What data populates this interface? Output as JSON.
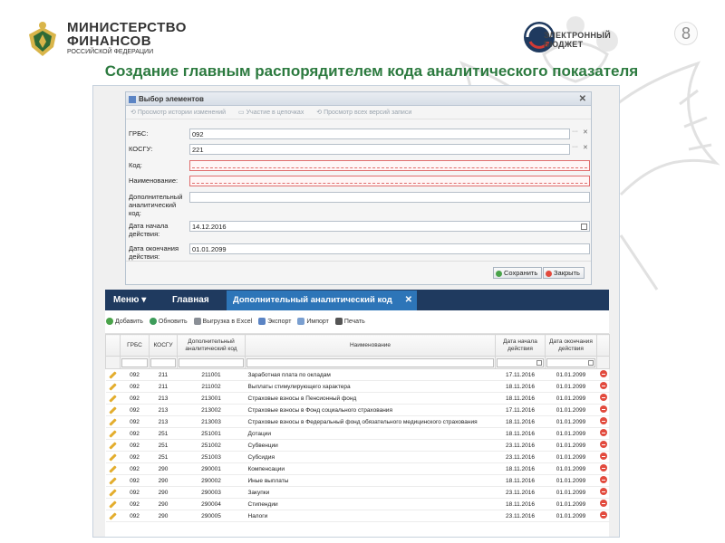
{
  "ministry": {
    "line1": "МИНИСТЕРСТВО",
    "line2": "ФИНАНСОВ",
    "line3": "РОССИЙСКОЙ ФЕДЕРАЦИИ"
  },
  "eb_logo": {
    "line1": "ЭЛЕКТРОННЫЙ",
    "line2": "БЮДЖЕТ"
  },
  "slide_number": "8",
  "title": "Создание главным распорядителем кода аналитического показателя",
  "modal": {
    "title": "Выбор элементов",
    "tools": [
      "Просмотр истории изменений",
      "Участие в цепочках",
      "Просмотр всех версий записи"
    ],
    "fields": [
      {
        "label": "ГРБС:",
        "value": "092"
      },
      {
        "label": "КОСГУ:",
        "value": "221"
      },
      {
        "label": "Код:",
        "value": ""
      },
      {
        "label": "Наименование:",
        "value": ""
      },
      {
        "label": "Дополнительный аналитический код:",
        "value": ""
      },
      {
        "label": "Дата начала действия:",
        "value": "14.12.2016"
      },
      {
        "label": "Дата окончания действия:",
        "value": "01.01.2099"
      }
    ],
    "save_label": "Сохранить",
    "close_label": "Закрыть"
  },
  "appbar": {
    "menu": "Меню",
    "main": "Главная",
    "active_tab": "Дополнительный аналитический код"
  },
  "toolbar": [
    "Добавить",
    "Обновить",
    "Выгрузка в Excel",
    "Экспорт",
    "Импорт",
    "Печать"
  ],
  "grid": {
    "headers": [
      "ГРБС",
      "КОСГУ",
      "Дополнительный аналитический код",
      "Наименование",
      "Дата начала действия",
      "Дата окончания действия"
    ],
    "rows": [
      [
        "092",
        "211",
        "211001",
        "Заработная плата по окладам",
        "17.11.2016",
        "01.01.2099"
      ],
      [
        "092",
        "211",
        "211002",
        "Выплаты стимулирующего характера",
        "18.11.2016",
        "01.01.2099"
      ],
      [
        "092",
        "213",
        "213001",
        "Страховые взносы в Пенсионный фонд",
        "18.11.2016",
        "01.01.2099"
      ],
      [
        "092",
        "213",
        "213002",
        "Страховые взносы в Фонд социального страхования",
        "17.11.2016",
        "01.01.2099"
      ],
      [
        "092",
        "213",
        "213003",
        "Страховые взносы в Федеральный фонд обязательного медицинского страхования",
        "18.11.2016",
        "01.01.2099"
      ],
      [
        "092",
        "251",
        "251001",
        "Дотации",
        "18.11.2016",
        "01.01.2099"
      ],
      [
        "092",
        "251",
        "251002",
        "Субвенции",
        "23.11.2016",
        "01.01.2099"
      ],
      [
        "092",
        "251",
        "251003",
        "Субсидия",
        "23.11.2016",
        "01.01.2099"
      ],
      [
        "092",
        "290",
        "290001",
        "Компенсации",
        "18.11.2016",
        "01.01.2099"
      ],
      [
        "092",
        "290",
        "290002",
        "Иные выплаты",
        "18.11.2016",
        "01.01.2099"
      ],
      [
        "092",
        "290",
        "290003",
        "Закупки",
        "23.11.2016",
        "01.01.2099"
      ],
      [
        "092",
        "290",
        "290004",
        "Стипендии",
        "18.11.2016",
        "01.01.2099"
      ],
      [
        "092",
        "290",
        "290005",
        "Налоги",
        "23.11.2016",
        "01.01.2099"
      ]
    ]
  },
  "colors": {
    "title": "#2c7a3f",
    "appbar": "#1f3a5f",
    "active_tab": "#2d75b8",
    "delete": "#e24a3d",
    "edit": "#e3ad2d"
  }
}
